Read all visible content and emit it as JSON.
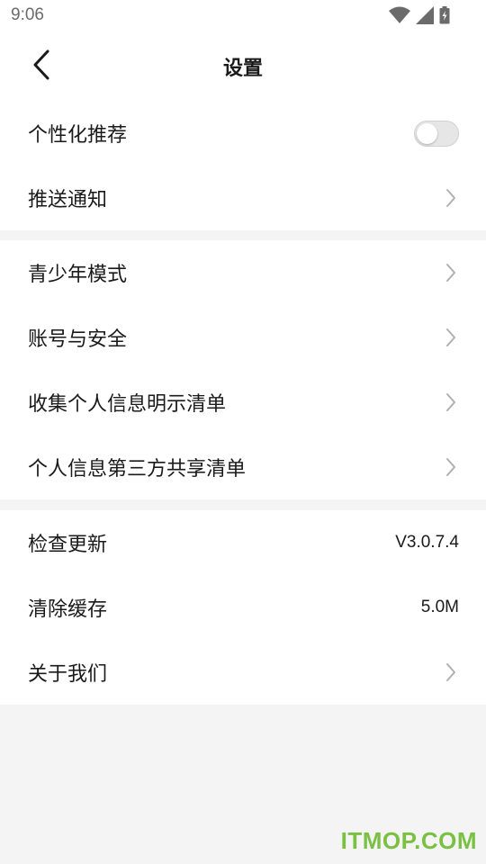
{
  "status_bar": {
    "time": "9:06",
    "icons": [
      "wifi-icon",
      "cell-signal-icon",
      "battery-charging-icon"
    ]
  },
  "header": {
    "title": "设置",
    "back_icon": "chevron-left-icon"
  },
  "groups": [
    {
      "items": [
        {
          "label": "个性化推荐",
          "control": "toggle",
          "toggle_on": false
        },
        {
          "label": "推送通知",
          "control": "chevron"
        }
      ]
    },
    {
      "items": [
        {
          "label": "青少年模式",
          "control": "chevron"
        },
        {
          "label": "账号与安全",
          "control": "chevron"
        },
        {
          "label": "收集个人信息明示清单",
          "control": "chevron"
        },
        {
          "label": "个人信息第三方共享清单",
          "control": "chevron"
        }
      ]
    },
    {
      "items": [
        {
          "label": "检查更新",
          "control": "value",
          "value": "V3.0.7.4"
        },
        {
          "label": "清除缓存",
          "control": "value",
          "value": "5.0M"
        },
        {
          "label": "关于我们",
          "control": "chevron"
        }
      ]
    }
  ],
  "watermark": "ITMOP.COM",
  "colors": {
    "background": "#f4f4f4",
    "surface": "#ffffff",
    "text": "#1a1a1a",
    "chevron": "#b0b0b0",
    "toggle_off": "#e6e6e6",
    "watermark": "#7ac143"
  }
}
